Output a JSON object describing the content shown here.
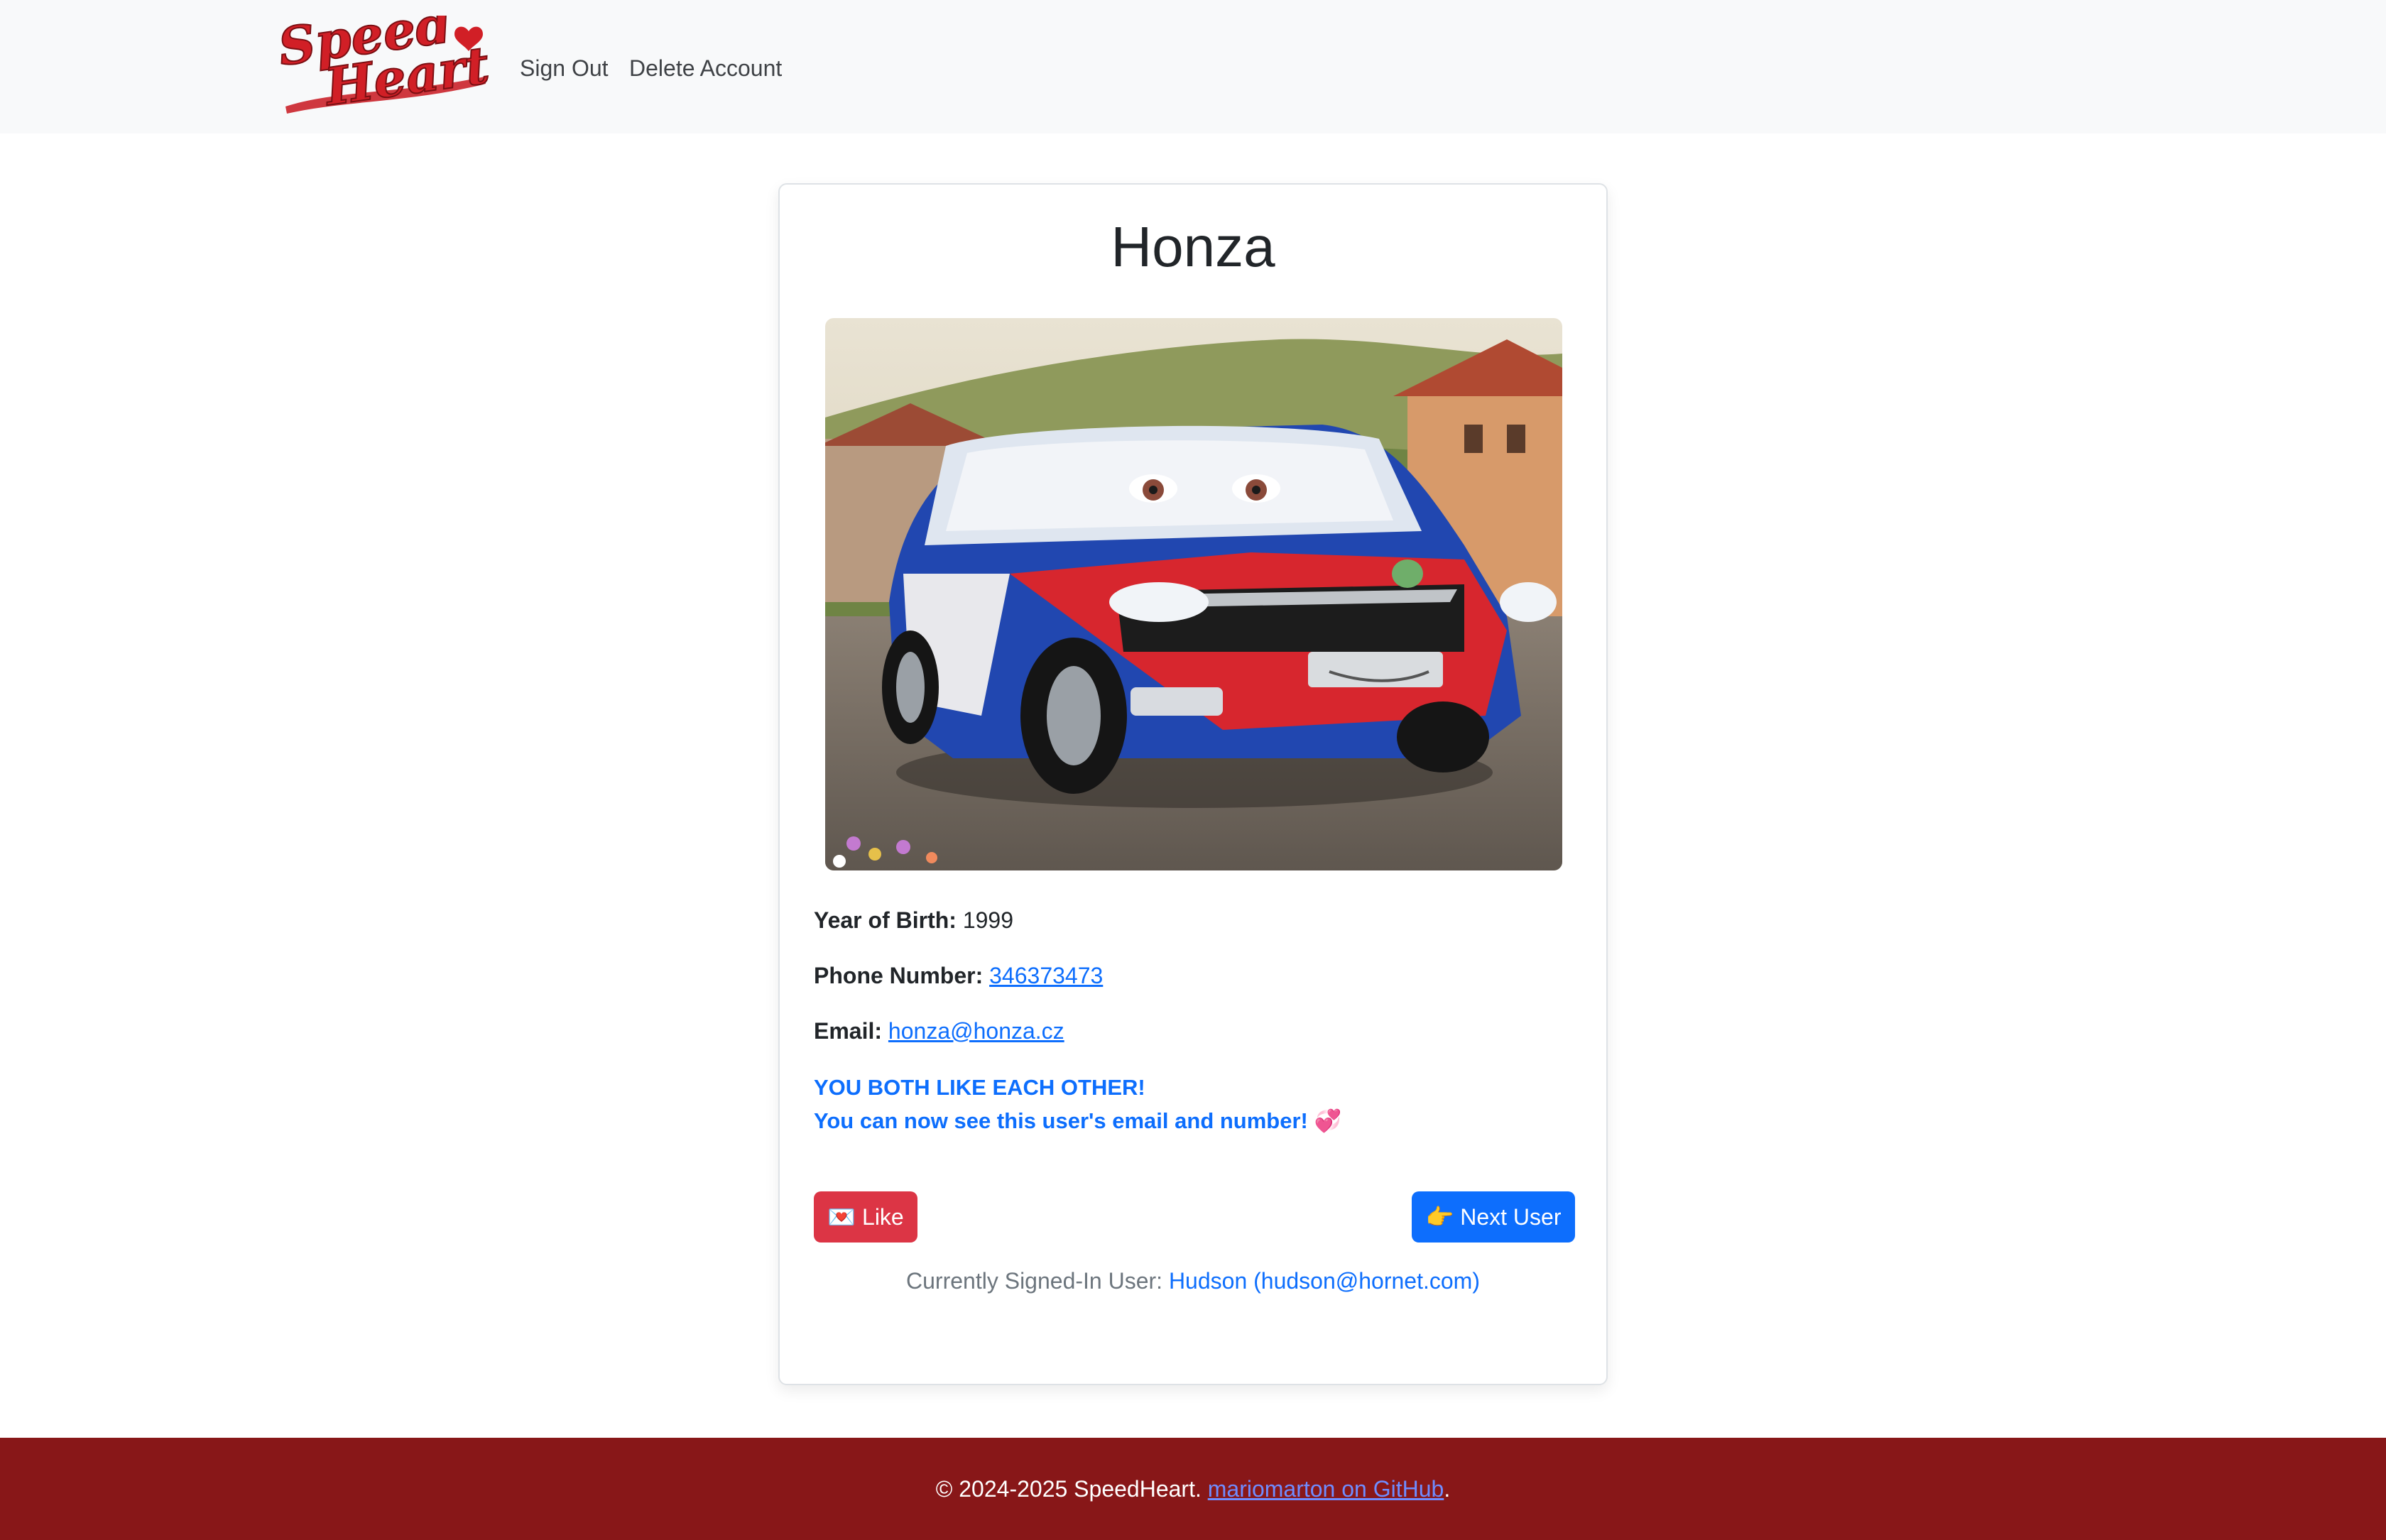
{
  "navbar": {
    "logo_text_line1": "Speed",
    "logo_text_line2": "Heart",
    "sign_out": "Sign Out",
    "delete_account": "Delete Account"
  },
  "profile": {
    "name": "Honza",
    "year_label": "Year of Birth:",
    "year_value": "1999",
    "phone_label": "Phone Number:",
    "phone_value": "346373473",
    "email_label": "Email:",
    "email_value": "honza@honza.cz",
    "match_line1": "YOU BOTH LIKE EACH OTHER!",
    "match_line2": "You can now see this user's email and number! 💞"
  },
  "actions": {
    "like_label": "💌 Like",
    "next_label": "👉 Next User"
  },
  "session": {
    "label": "Currently Signed-In User:",
    "user": "Hudson (hudson@hornet.com)"
  },
  "footer": {
    "copyright": "© 2024-2025 SpeedHeart.",
    "link_text": "mariomarton on GitHub",
    "end": "."
  },
  "colors": {
    "brand_red": "#881718",
    "like_button": "#dc3545",
    "primary": "#0d6efd",
    "navbar_bg": "#f8f9fa"
  }
}
